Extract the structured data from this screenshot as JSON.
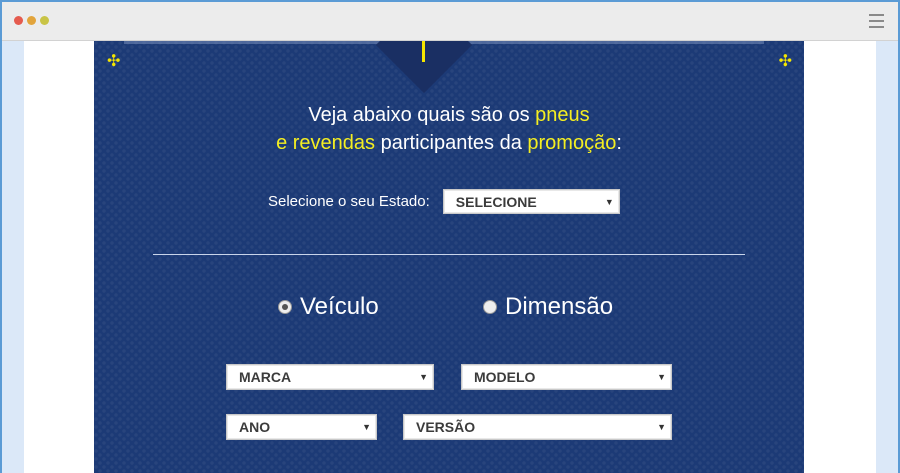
{
  "browser": {
    "controls": [
      "close-dot",
      "minimize-dot",
      "maximize-dot"
    ],
    "menu_icon": "hamburger-icon"
  },
  "panel": {
    "headline": {
      "line1_part1": "Veja abaixo quais são os ",
      "line1_highlight": "pneus",
      "line2_highlight1": "e revendas",
      "line2_part2": " participantes da ",
      "line2_highlight2": "promoção",
      "line2_colon": ":"
    },
    "state_label": "Selecione o seu Estado:",
    "state_select": "SELECIONE",
    "search_type": {
      "option1": "Veículo",
      "option2": "Dimensão",
      "selected": "Veículo"
    },
    "selects": {
      "marca": "MARCA",
      "modelo": "MODELO",
      "ano": "ANO",
      "versao": "VERSÃO"
    },
    "caret": "▼",
    "move_handle": "✣"
  },
  "colors": {
    "panel_bg": "#1c3a76",
    "highlight": "#f4ee21",
    "text": "#ffffff",
    "page_outer": "#dbe8f8"
  }
}
